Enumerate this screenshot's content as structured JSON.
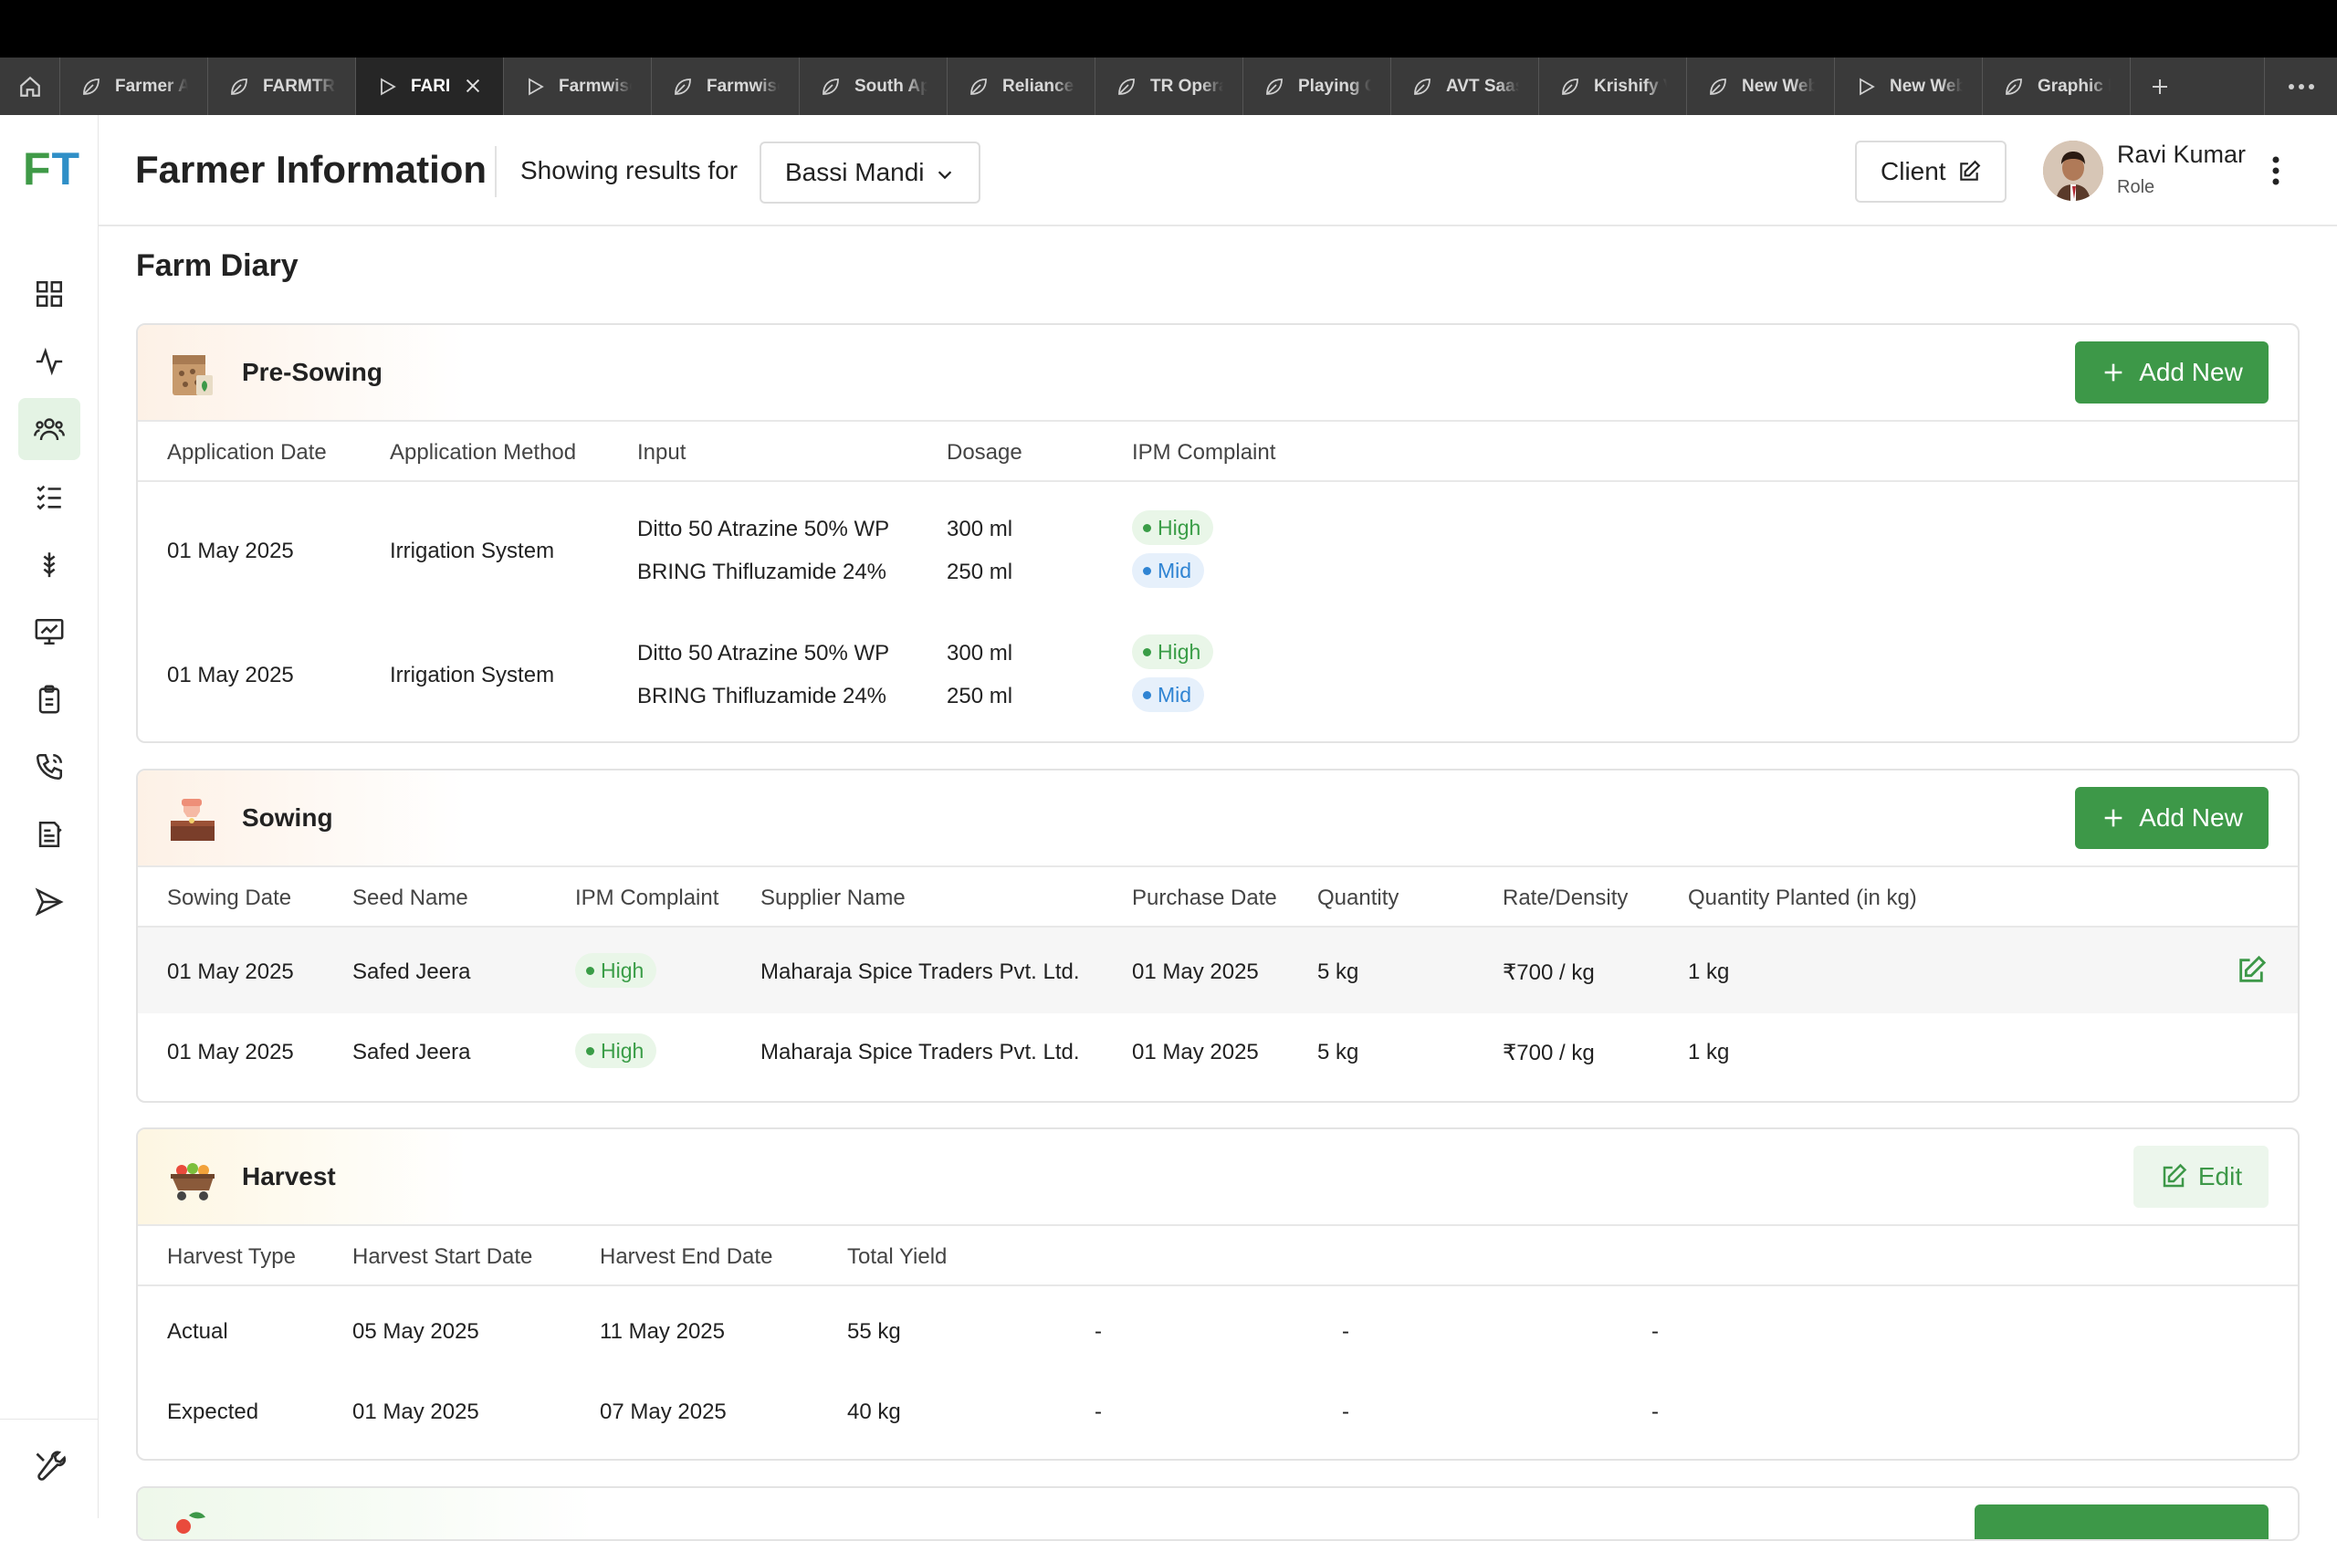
{
  "browser": {
    "tabs": [
      {
        "label": "Farmer A",
        "icon": "leaf-icon",
        "active": false
      },
      {
        "label": "FARMTRA",
        "icon": "leaf-icon",
        "active": false
      },
      {
        "label": "FARI",
        "icon": "play-icon",
        "active": true
      },
      {
        "label": "Farmwise",
        "icon": "play-icon",
        "active": false
      },
      {
        "label": "Farmwise",
        "icon": "leaf-icon",
        "active": false
      },
      {
        "label": "South Ap",
        "icon": "leaf-icon",
        "active": false
      },
      {
        "label": "Reliance",
        "icon": "leaf-icon",
        "active": false
      },
      {
        "label": "TR Opera",
        "icon": "leaf-icon",
        "active": false
      },
      {
        "label": "Playing C",
        "icon": "leaf-icon",
        "active": false
      },
      {
        "label": "AVT Saas",
        "icon": "leaf-icon",
        "active": false
      },
      {
        "label": "Krishify V",
        "icon": "leaf-icon",
        "active": false
      },
      {
        "label": "New Web",
        "icon": "leaf-icon",
        "active": false
      },
      {
        "label": "New Web",
        "icon": "play-icon",
        "active": false
      },
      {
        "label": "Graphic D",
        "icon": "leaf-icon",
        "active": false
      }
    ]
  },
  "app": {
    "logo_f": "F",
    "logo_t": "T",
    "sidebar_icons": [
      "grid-icon",
      "activity-icon",
      "users-icon",
      "checklist-icon",
      "crop-icon",
      "monitor-chart-icon",
      "clipboard-icon",
      "phone-icon",
      "report-icon",
      "send-icon"
    ],
    "sidebar_active": "users-icon",
    "sidebar_bottom_icon": "tools-icon"
  },
  "header": {
    "title": "Farmer Information",
    "showing_label": "Showing results for",
    "location": "Bassi Mandi",
    "client_label": "Client",
    "user_name": "Ravi Kumar",
    "user_role": "Role"
  },
  "page": {
    "section_title": "Farm Diary"
  },
  "pre_sowing": {
    "title": "Pre-Sowing",
    "add_label": "Add New",
    "columns": [
      "Application Date",
      "Application Method",
      "Input",
      "Dosage",
      "IPM Complaint"
    ],
    "rows": [
      {
        "date": "01 May 2025",
        "method": "Irrigation System",
        "inputs": [
          "Ditto 50 Atrazine 50% WP",
          "BRING Thifluzamide 24%"
        ],
        "dosages": [
          "300 ml",
          "250 ml"
        ],
        "ipm": [
          "High",
          "Mid"
        ]
      },
      {
        "date": "01 May 2025",
        "method": "Irrigation System",
        "inputs": [
          "Ditto 50 Atrazine 50% WP",
          "BRING Thifluzamide 24%"
        ],
        "dosages": [
          "300 ml",
          "250 ml"
        ],
        "ipm": [
          "High",
          "Mid"
        ]
      }
    ]
  },
  "sowing": {
    "title": "Sowing",
    "add_label": "Add New",
    "columns": [
      "Sowing Date",
      "Seed Name",
      "IPM Complaint",
      "Supplier Name",
      "Purchase Date",
      "Quantity",
      "Rate/Density",
      "Quantity Planted (in kg)"
    ],
    "rows": [
      {
        "date": "01 May 2025",
        "seed": "Safed Jeera",
        "ipm": "High",
        "supplier": "Maharaja Spice Traders Pvt. Ltd.",
        "purchase": "01 May 2025",
        "qty": "5 kg",
        "rate": "₹700 / kg",
        "planted": "1 kg"
      },
      {
        "date": "01 May 2025",
        "seed": "Safed Jeera",
        "ipm": "High",
        "supplier": "Maharaja Spice Traders Pvt. Ltd.",
        "purchase": "01 May 2025",
        "qty": "5 kg",
        "rate": "₹700 / kg",
        "planted": "1 kg"
      }
    ]
  },
  "harvest": {
    "title": "Harvest",
    "edit_label": "Edit",
    "columns": [
      "Harvest Type",
      "Harvest Start Date",
      "Harvest End Date",
      "Total Yield"
    ],
    "rows": [
      {
        "type": "Actual",
        "start": "05 May 2025",
        "end": "11 May 2025",
        "yield": "55 kg",
        "d1": "-",
        "d2": "-",
        "d3": "-"
      },
      {
        "type": "Expected",
        "start": "01 May 2025",
        "end": "07 May 2025",
        "yield": "40 kg",
        "d1": "-",
        "d2": "-",
        "d3": "-"
      }
    ]
  },
  "colors": {
    "brand_green": "#3d9848",
    "logo_blue": "#2f8fc7",
    "badge_high": "#3a9d47",
    "badge_mid": "#2f84d3"
  }
}
